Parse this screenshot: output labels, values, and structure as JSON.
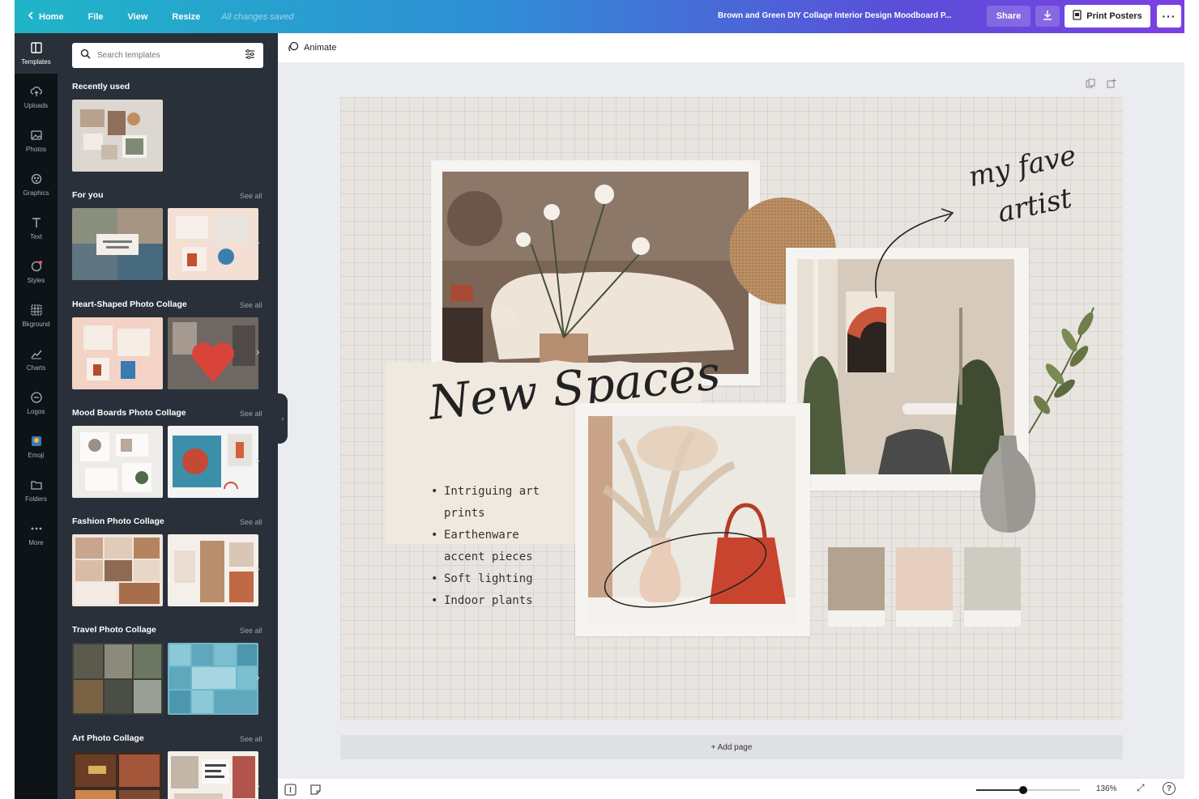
{
  "topbar": {
    "home": "Home",
    "file": "File",
    "view": "View",
    "resize": "Resize",
    "saved": "All changes saved",
    "title": "Brown and Green DIY Collage Interior Design Moodboard P...",
    "share": "Share",
    "print": "Print Posters",
    "more": "···"
  },
  "rail": [
    {
      "label": "Templates",
      "icon": "templates-icon"
    },
    {
      "label": "Uploads",
      "icon": "upload-cloud-icon"
    },
    {
      "label": "Photos",
      "icon": "photo-icon"
    },
    {
      "label": "Graphics",
      "icon": "shapes-icon"
    },
    {
      "label": "Text",
      "icon": "text-t-icon"
    },
    {
      "label": "Styles",
      "icon": "palette-icon"
    },
    {
      "label": "Bkground",
      "icon": "background-pattern-icon"
    },
    {
      "label": "Charts",
      "icon": "chart-line-icon"
    },
    {
      "label": "Logos",
      "icon": "logo-badge-icon"
    },
    {
      "label": "Emoji",
      "icon": "emoji-icon"
    },
    {
      "label": "Folders",
      "icon": "folder-icon"
    },
    {
      "label": "More",
      "icon": "more-dots-icon"
    }
  ],
  "panel": {
    "search_placeholder": "Search templates",
    "recent": "Recently used",
    "see_all": "See all",
    "sections": [
      "For you",
      "Heart-Shaped Photo Collage",
      "Mood Boards Photo Collage",
      "Fashion Photo Collage",
      "Travel Photo Collage",
      "Art Photo Collage"
    ]
  },
  "editor": {
    "animate": "Animate",
    "add_page": "+ Add page",
    "zoom": "136%",
    "zoom_level": 0.45,
    "help": "?"
  },
  "design": {
    "heading": "New Spaces",
    "caption_line1": "my fave",
    "caption_line2": "artist",
    "bullets": [
      [
        "Intriguing art",
        "prints"
      ],
      [
        "Earthenware",
        "accent pieces"
      ],
      [
        "Soft lighting"
      ],
      [
        "Indoor plants"
      ]
    ],
    "swatches": [
      "#b2a290",
      "#e7cfc2",
      "#cdccc1"
    ]
  },
  "colors": {
    "rail_bg": "#0e1318",
    "panel_bg": "#293039",
    "page_bg": "#e8e5e0"
  }
}
